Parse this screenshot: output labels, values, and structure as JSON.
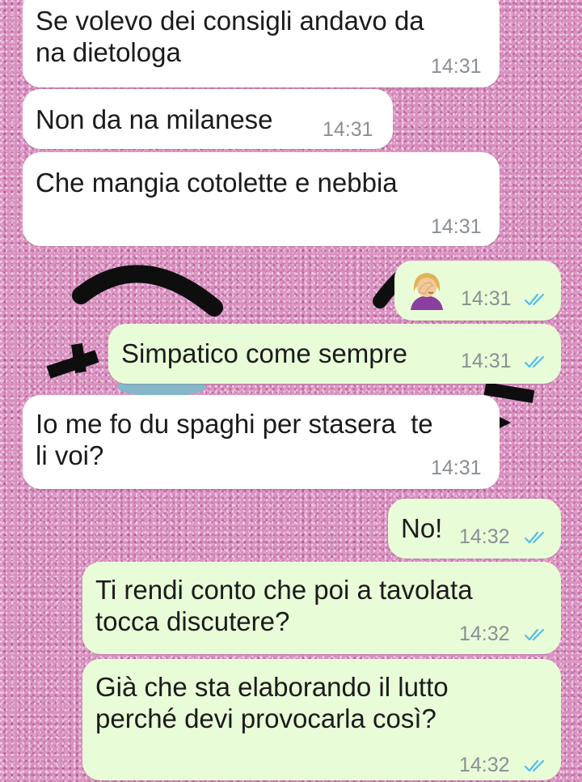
{
  "chat": {
    "messages": [
      {
        "id": 1,
        "direction": "incoming",
        "text": "Se volevo dei consigli andavo da\nna dietologa",
        "time": "14:31"
      },
      {
        "id": 2,
        "direction": "incoming",
        "text": "Non da na milanese",
        "time": "14:31"
      },
      {
        "id": 3,
        "direction": "incoming",
        "text": "Che mangia cotolette e nebbia",
        "time": "14:31"
      },
      {
        "id": 4,
        "direction": "outgoing",
        "emoji": "woman-facepalming-icon",
        "time": "14:31",
        "status": "read"
      },
      {
        "id": 5,
        "direction": "outgoing",
        "text": "Simpatico come sempre",
        "time": "14:31",
        "status": "read"
      },
      {
        "id": 6,
        "direction": "incoming",
        "text": "Io me fo du spaghi per stasera  te\nli voi?",
        "time": "14:31"
      },
      {
        "id": 7,
        "direction": "outgoing",
        "text": "No!",
        "time": "14:32",
        "status": "read"
      },
      {
        "id": 8,
        "direction": "outgoing",
        "text": "Ti rendi conto che poi a tavolata\ntocca discutere?",
        "time": "14:32",
        "status": "read"
      },
      {
        "id": 9,
        "direction": "outgoing",
        "text": "Già che sta elaborando il lutto\nperché devi provocarla così?",
        "time": "14:32",
        "status": "read"
      }
    ]
  },
  "colors": {
    "incoming_bubble": "#ffffff",
    "outgoing_bubble": "#e9fcd8",
    "timestamp": "#8a8f94",
    "read_check": "#53bdeb",
    "wallpaper": "#d98fc0"
  }
}
